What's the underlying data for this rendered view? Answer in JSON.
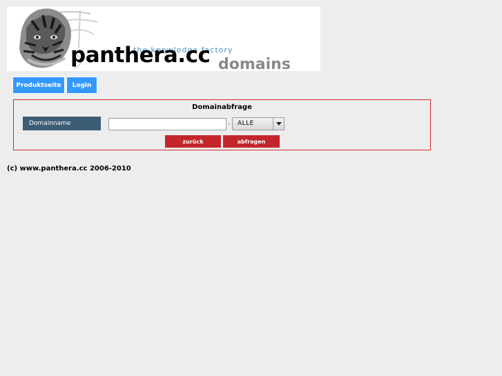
{
  "header": {
    "brand_name": "panthera.cc",
    "brand_sub": "domains",
    "tagline": "the knowledge factory",
    "logo_icon": "tiger-head-icon"
  },
  "nav": {
    "items": [
      {
        "label": "Produktseite"
      },
      {
        "label": "Login"
      }
    ]
  },
  "query": {
    "title": "Domainabfrage",
    "domain_label": "Domainname",
    "domain_value": "",
    "separator": ".",
    "tld_selected": "ALLE",
    "back_label": "zurück",
    "submit_label": "abfragen"
  },
  "footer": {
    "copyright": "(c) www.panthera.cc 2006-2010"
  },
  "colors": {
    "nav_button": "#3399ff",
    "action_button": "#c3262b",
    "box_border": "#c9302c",
    "label_bg": "#3d5d75",
    "tagline": "#4a90c8",
    "page_bg": "#ededed"
  }
}
